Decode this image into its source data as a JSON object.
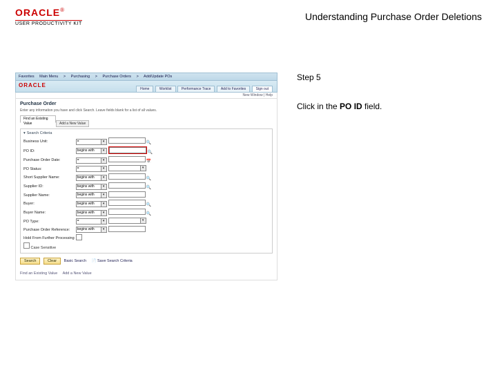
{
  "header": {
    "brand": "ORACLE",
    "reg": "®",
    "upk": "USER PRODUCTIVITY KIT",
    "title": "Understanding Purchase Order Deletions"
  },
  "instruction": {
    "step": "Step 5",
    "text_pre": "Click in the ",
    "text_bold": "PO ID",
    "text_post": " field."
  },
  "crumbs": [
    "Favorites",
    "Main Menu",
    "Purchasing",
    "Purchase Orders",
    "Add/Update POs"
  ],
  "obar": {
    "logo": "ORACLE",
    "tabs": [
      "Home",
      "Worklist",
      "Performance Trace",
      "Add to Favorites",
      "Sign out"
    ]
  },
  "subbar": "New Window | Help",
  "po": {
    "heading": "Purchase Order",
    "desc": "Enter any information you have and click Search. Leave fields blank for a list of all values.",
    "tabs": [
      "Find an Existing Value",
      "Add a New Value"
    ],
    "panel_header": "Search Criteria",
    "fields": {
      "bu": {
        "label": "Business Unit:",
        "op": "=",
        "val": ""
      },
      "poid": {
        "label": "PO ID:",
        "op": "begins with"
      },
      "podate": {
        "label": "Purchase Order Date:",
        "op": "="
      },
      "postat": {
        "label": "PO Status:",
        "op": "="
      },
      "shortsup": {
        "label": "Short Supplier Name:",
        "op": "begins with"
      },
      "supid": {
        "label": "Supplier ID:",
        "op": "begins with"
      },
      "supname": {
        "label": "Supplier Name:",
        "op": "begins with"
      },
      "buyer": {
        "label": "Buyer:",
        "op": "begins with"
      },
      "buyername": {
        "label": "Buyer Name:",
        "op": "begins with"
      },
      "potype": {
        "label": "PO Type:",
        "op": "="
      },
      "ref": {
        "label": "Purchase Order Reference:",
        "op": "begins with"
      },
      "hold": {
        "label": "Hold From Further Processing"
      },
      "cs": {
        "label": "Case Sensitive"
      }
    },
    "buttons": {
      "search": "Search",
      "clear": "Clear",
      "basic": "Basic Search",
      "save": "Save Search Criteria"
    },
    "foot": [
      "Find an Existing Value",
      "Add a New Value"
    ]
  }
}
